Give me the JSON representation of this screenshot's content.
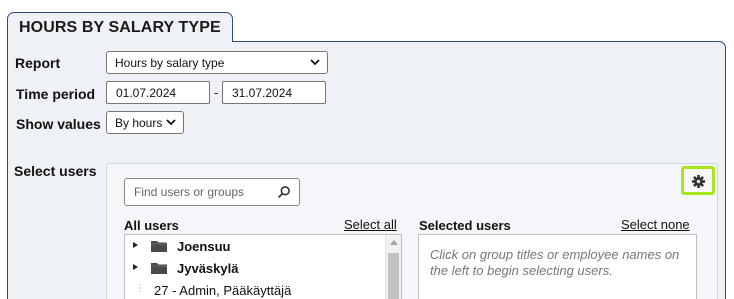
{
  "tab": {
    "title": "HOURS BY SALARY TYPE"
  },
  "form": {
    "report_label": "Report",
    "report_value": "Hours by salary type",
    "time_period_label": "Time period",
    "date_from": "01.07.2024",
    "date_separator": "-",
    "date_to": "31.07.2024",
    "show_values_label": "Show values",
    "show_values_value": "By hours"
  },
  "users": {
    "label": "Select users",
    "search_placeholder": "Find users or groups",
    "all_users_heading": "All users",
    "select_all": "Select all",
    "selected_users_heading": "Selected users",
    "select_none": "Select none",
    "groups": [
      {
        "name": "Joensuu"
      },
      {
        "name": "Jyväskylä"
      }
    ],
    "user_items": [
      {
        "name": "27 - Admin, Pääkäyttäjä"
      }
    ],
    "selected_hint": "Click on group titles or employee names on the left to begin selecting users."
  },
  "icons": {
    "search": "search-icon",
    "gear": "gear-icon",
    "folder": "folder-icon",
    "caret": "caret-right-icon",
    "chevron": "chevron-down-icon"
  },
  "colors": {
    "panel_bg": "#eef2f7",
    "panel_border": "#2e4d6b",
    "gear_highlight": "#a8e61d"
  }
}
